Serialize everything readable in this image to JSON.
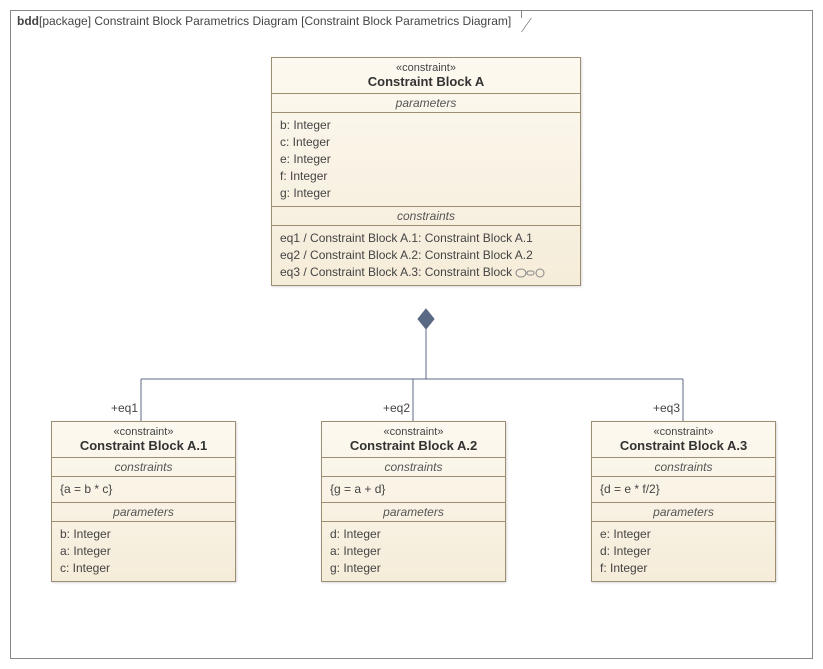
{
  "frame": {
    "kind": "bdd",
    "scope": "[package]",
    "title": "Constraint Block Parametrics Diagram",
    "bracket": "[Constraint Block Parametrics Diagram]"
  },
  "parent": {
    "stereo": "«constraint»",
    "name": "Constraint Block A",
    "paramsTitle": "parameters",
    "params": [
      "b: Integer",
      "c: Integer",
      "e: Integer",
      "f: Integer",
      "g: Integer"
    ],
    "consTitle": "constraints",
    "cons": [
      "eq1 / Constraint Block A.1: Constraint Block A.1",
      "eq2 / Constraint Block A.2: Constraint Block A.2",
      "eq3 / Constraint Block A.3: Constraint Block"
    ]
  },
  "roles": {
    "r1": "+eq1",
    "r2": "+eq2",
    "r3": "+eq3"
  },
  "childA": {
    "stereo": "«constraint»",
    "name": "Constraint Block A.1",
    "consTitle": "constraints",
    "cons": [
      "{a = b * c}"
    ],
    "paramsTitle": "parameters",
    "params": [
      "b: Integer",
      "a: Integer",
      "c: Integer"
    ]
  },
  "childB": {
    "stereo": "«constraint»",
    "name": "Constraint Block A.2",
    "consTitle": "constraints",
    "cons": [
      "{g = a + d}"
    ],
    "paramsTitle": "parameters",
    "params": [
      "d: Integer",
      "a: Integer",
      "g: Integer"
    ]
  },
  "childC": {
    "stereo": "«constraint»",
    "name": "Constraint Block A.3",
    "consTitle": "constraints",
    "cons": [
      "{d = e *  f/2}"
    ],
    "paramsTitle": "parameters",
    "params": [
      "e: Integer",
      "d: Integer",
      "f: Integer"
    ]
  }
}
